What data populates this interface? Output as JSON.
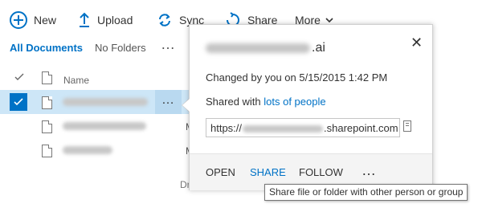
{
  "toolbar": {
    "new_label": "New",
    "upload_label": "Upload",
    "sync_label": "Sync",
    "share_label": "Share",
    "more_label": "More"
  },
  "views": {
    "all_documents": "All Documents",
    "no_folders": "No Folders",
    "more": "…"
  },
  "list": {
    "name_header": "Name",
    "row_more": "…",
    "row_trunc": "M",
    "rows": [
      {
        "selected": true
      },
      {
        "selected": false
      },
      {
        "selected": false
      }
    ]
  },
  "callout": {
    "title_suffix": ".ai",
    "changed_text": "Changed by you on 5/15/2015 1:42 PM",
    "shared_prefix": "Shared with ",
    "shared_link": "lots of people",
    "url_prefix": "https://",
    "url_suffix": ".sharepoint.com",
    "close_icon": "✕",
    "footer": {
      "open": "OPEN",
      "share": "SHARE",
      "follow": "FOLLOW",
      "more": "…"
    }
  },
  "drag_hint": "Dr",
  "tooltip": "Share file or folder with other person or group",
  "colors": {
    "accent": "#0072c6",
    "selected_row": "#cde6f7"
  }
}
